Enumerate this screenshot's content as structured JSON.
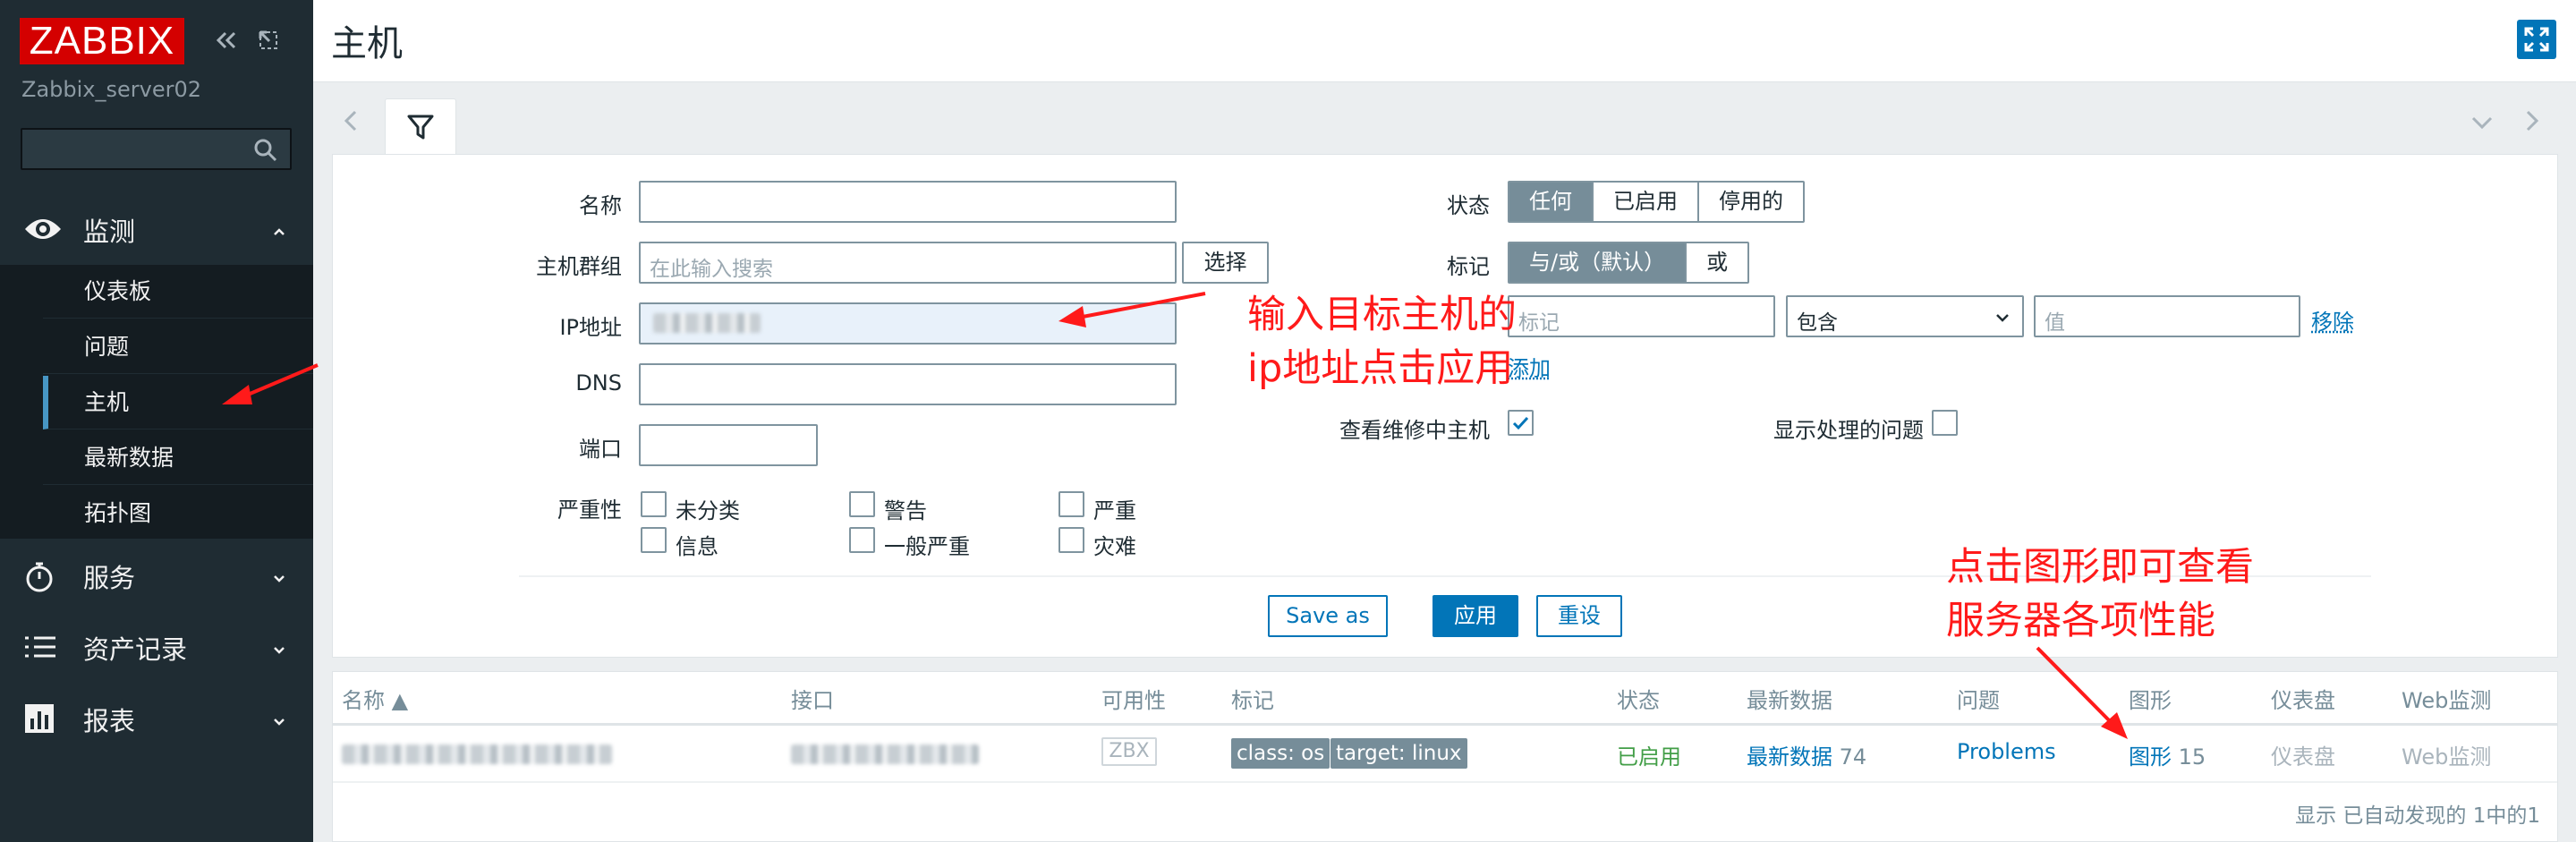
{
  "sidebar": {
    "logo": "ZABBIX",
    "server": "Zabbix_server02",
    "search_placeholder": "",
    "menu": [
      {
        "label": "监测",
        "icon": "eye-icon"
      },
      {
        "label": "服务",
        "icon": "stopwatch-icon"
      },
      {
        "label": "资产记录",
        "icon": "list-icon"
      },
      {
        "label": "报表",
        "icon": "bar-chart-icon"
      }
    ],
    "monitoring_items": [
      "仪表板",
      "问题",
      "主机",
      "最新数据",
      "拓扑图"
    ]
  },
  "header": {
    "title": "主机"
  },
  "filter": {
    "name_label": "名称",
    "name_value": "",
    "hostgroup_label": "主机群组",
    "hostgroup_placeholder": "在此输入搜索",
    "select_button": "选择",
    "ip_label": "IP地址",
    "dns_label": "DNS",
    "port_label": "端口",
    "severity_label": "严重性",
    "severities": [
      "未分类",
      "警告",
      "严重",
      "信息",
      "一般严重",
      "灾难"
    ],
    "status_label": "状态",
    "status_options": [
      "任何",
      "已启用",
      "停用的"
    ],
    "status_selected": "任何",
    "tags_label": "标记",
    "tag_mode_options": [
      "与/或（默认）",
      "或"
    ],
    "tag_mode_selected": "与/或（默认）",
    "tag_placeholder": "标记",
    "tag_operator": "包含",
    "tag_value_placeholder": "值",
    "remove_link": "移除",
    "add_link": "添加",
    "maintenance_label": "查看维修中主机",
    "maintenance_checked": true,
    "show_suppressed_label": "显示处理的问题",
    "show_suppressed_checked": false,
    "save_as": "Save as",
    "apply": "应用",
    "reset": "重设"
  },
  "table": {
    "columns": [
      "名称 ▲",
      "接口",
      "可用性",
      "标记",
      "状态",
      "最新数据",
      "问题",
      "图形",
      "仪表盘",
      "Web监测"
    ],
    "row": {
      "availability": "ZBX",
      "tags": [
        "class: os",
        "target: linux"
      ],
      "status": "已启用",
      "latest_data_link": "最新数据",
      "latest_data_count": "74",
      "problems_link": "Problems",
      "graphs_link": "图形",
      "graphs_count": "15",
      "dashboards": "仪表盘",
      "web": "Web监测"
    },
    "footer": "显示 已自动发现的 1中的1"
  },
  "annotations": {
    "ip_hint_line1": "输入目标主机的",
    "ip_hint_line2": "ip地址点击应用",
    "graph_hint_line1": "点击图形即可查看",
    "graph_hint_line2": "服务器各项性能"
  },
  "colors": {
    "sidebar_bg": "#1f2c33",
    "logo_red": "#d40000",
    "primary_blue": "#0275b8",
    "status_green": "#429e47",
    "annotation_red": "#ff1a1a"
  }
}
